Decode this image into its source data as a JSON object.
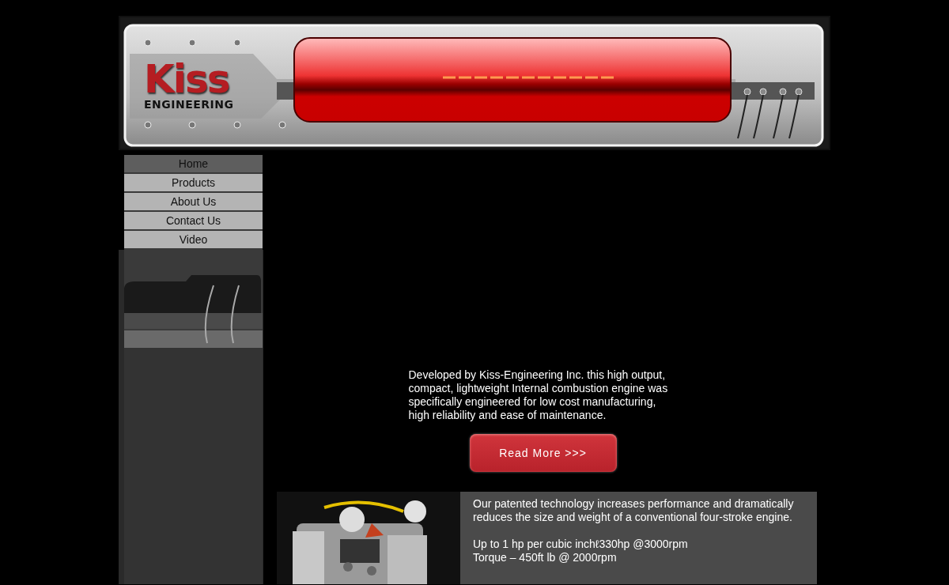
{
  "header": {
    "logo": {
      "word": "Kiss",
      "subtitle": "ENGINEERING"
    }
  },
  "nav": {
    "items": [
      {
        "label": "Home",
        "selected": true
      },
      {
        "label": "Products",
        "selected": false
      },
      {
        "label": "About Us",
        "selected": false
      },
      {
        "label": "Contact Us",
        "selected": false
      },
      {
        "label": "Video",
        "selected": false
      }
    ]
  },
  "intro": {
    "text": "Developed by Kiss-Engineering Inc. this high output, compact, lightweight Internal combustion engine was specifically engineered for low cost manufacturing, high reliability and ease of maintenance.",
    "button": "Read More >>>"
  },
  "feature": {
    "image": {
      "kind": "picture"
    },
    "paragraphs": [
      "Our patented technology increases performance and dramatically reduces the size and weight of a conventional four-stroke engine."
    ],
    "specs": [
      "Up to 1 hp per cubic inchℓ330hp @3000rpm",
      "Torque – 450ft lb @ 2000rpm"
    ]
  }
}
